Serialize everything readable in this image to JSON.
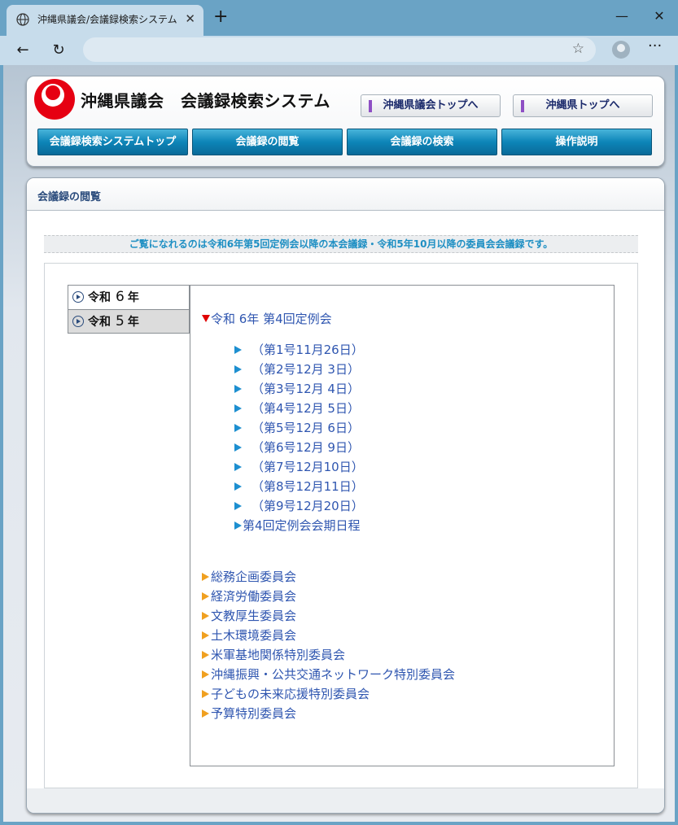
{
  "browser": {
    "tab_title": "沖縄県議会/会議録検索システム",
    "tab_close": "✕",
    "new_tab": "+",
    "min": "—",
    "max": "☐",
    "close": "✕",
    "back": "←",
    "reload": "↻",
    "star": "☆",
    "more": "···"
  },
  "header": {
    "title": "沖縄県議会　会議録検索システム",
    "top_links": [
      "沖縄県議会トップへ",
      "沖縄県トップへ"
    ],
    "nav": [
      "会議録検索システムトップ",
      "会議録の閲覧",
      "会議録の検索",
      "操作説明"
    ],
    "logo_colors": {
      "red": "#e60012",
      "white": "#ffffff"
    }
  },
  "content": {
    "section_title": "会議録の閲覧",
    "notice": "ご覧になれるのは令和6年第5回定例会以降の本会議録・令和5年10月以降の委員会会議録です。",
    "years": [
      {
        "era": "令和",
        "num": "6",
        "suffix": "年",
        "active": false
      },
      {
        "era": "令和",
        "num": "5",
        "suffix": "年",
        "active": true
      }
    ],
    "session_title": "令和 6年 第4回定例会",
    "documents": [
      "（第1号11月26日）",
      "（第2号12月 3日）",
      "（第3号12月 4日）",
      "（第4号12月 5日）",
      "（第5号12月 6日）",
      "（第6号12月 9日）",
      "（第7号12月10日）",
      "（第8号12月11日）",
      "（第9号12月20日）"
    ],
    "schedule": "第4回定例会会期日程",
    "committees": [
      "総務企画委員会",
      "経済労働委員会",
      "文教厚生委員会",
      "土木環境委員会",
      "米軍基地関係特別委員会",
      "沖縄振興・公共交通ネットワーク特別委員会",
      "子どもの未来応援特別委員会",
      "予算特別委員会"
    ]
  }
}
